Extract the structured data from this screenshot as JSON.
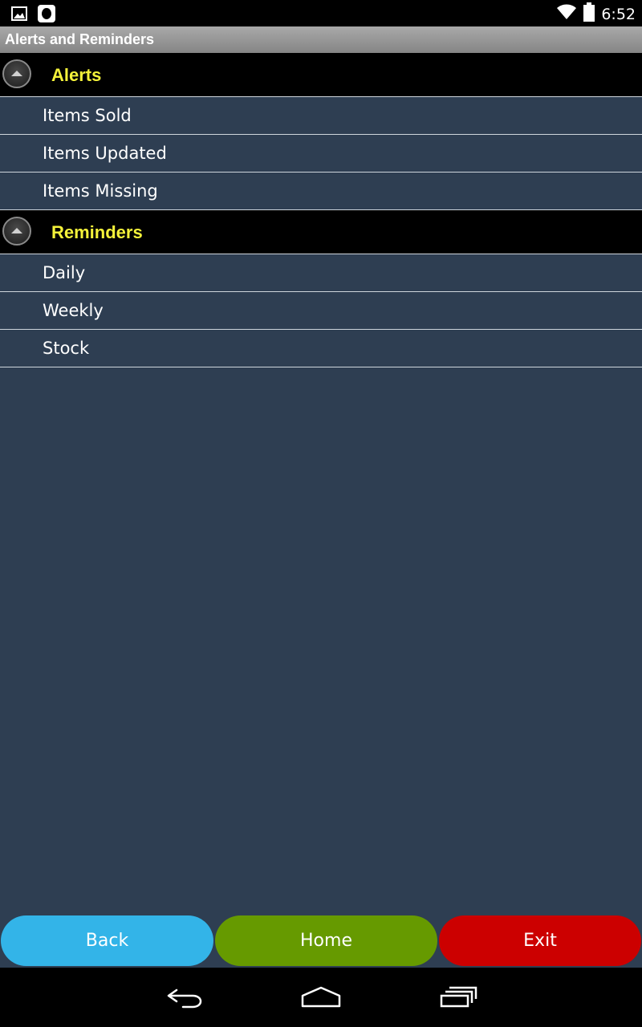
{
  "status_bar": {
    "time": "6:52",
    "icons": [
      "gallery-icon",
      "app-notification-icon",
      "wifi-icon",
      "battery-icon"
    ]
  },
  "header": {
    "title": "Alerts and Reminders"
  },
  "sections": [
    {
      "label": "Alerts",
      "items": [
        {
          "label": "Items Sold"
        },
        {
          "label": "Items Updated"
        },
        {
          "label": "Items Missing"
        }
      ]
    },
    {
      "label": "Reminders",
      "items": [
        {
          "label": "Daily"
        },
        {
          "label": "Weekly"
        },
        {
          "label": "Stock"
        }
      ]
    }
  ],
  "footer": {
    "back_label": "Back",
    "home_label": "Home",
    "exit_label": "Exit"
  },
  "colors": {
    "background": "#2e3e52",
    "section_label": "#f4f23a",
    "back": "#33b4e8",
    "home": "#669a00",
    "exit": "#cc0000"
  },
  "nav_bar": {
    "icons": [
      "back-nav-icon",
      "home-nav-icon",
      "recents-nav-icon"
    ]
  }
}
